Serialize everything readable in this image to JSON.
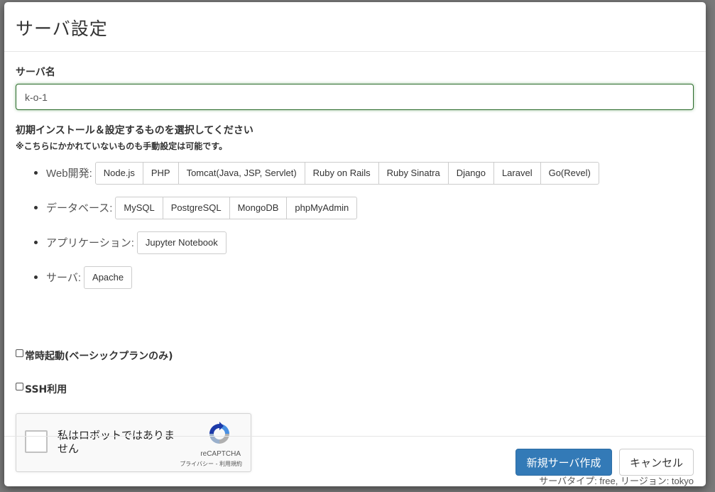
{
  "modal": {
    "title": "サーバ設定"
  },
  "server_name": {
    "label": "サーバ名",
    "value": "k-o-1"
  },
  "install": {
    "title": "初期インストール＆設定するものを選択してください",
    "note": "※こちらにかかれていないものも手動設定は可能です。",
    "groups": [
      {
        "label": "Web開発:",
        "options": [
          "Node.js",
          "PHP",
          "Tomcat(Java, JSP, Servlet)",
          "Ruby on Rails",
          "Ruby Sinatra",
          "Django",
          "Laravel",
          "Go(Revel)"
        ]
      },
      {
        "label": "データベース:",
        "options": [
          "MySQL",
          "PostgreSQL",
          "MongoDB",
          "phpMyAdmin"
        ]
      },
      {
        "label": "アプリケーション:",
        "options": [
          "Jupyter Notebook"
        ]
      },
      {
        "label": "サーバ:",
        "options": [
          "Apache"
        ]
      }
    ]
  },
  "checkboxes": {
    "always_on": "常時起動(ベーシックプランのみ)",
    "ssh": "SSH利用"
  },
  "recaptcha": {
    "text": "私はロボットではありません",
    "brand": "reCAPTCHA",
    "links": "プライバシー - 利用規約"
  },
  "server_type": "サーバタイプ: free, リージョン: tokyo",
  "footer": {
    "create_label": "新規サーバ作成",
    "cancel_label": "キャンセル"
  },
  "colors": {
    "primary": "#337ab7",
    "input_focus_border": "#2b6b2b"
  }
}
